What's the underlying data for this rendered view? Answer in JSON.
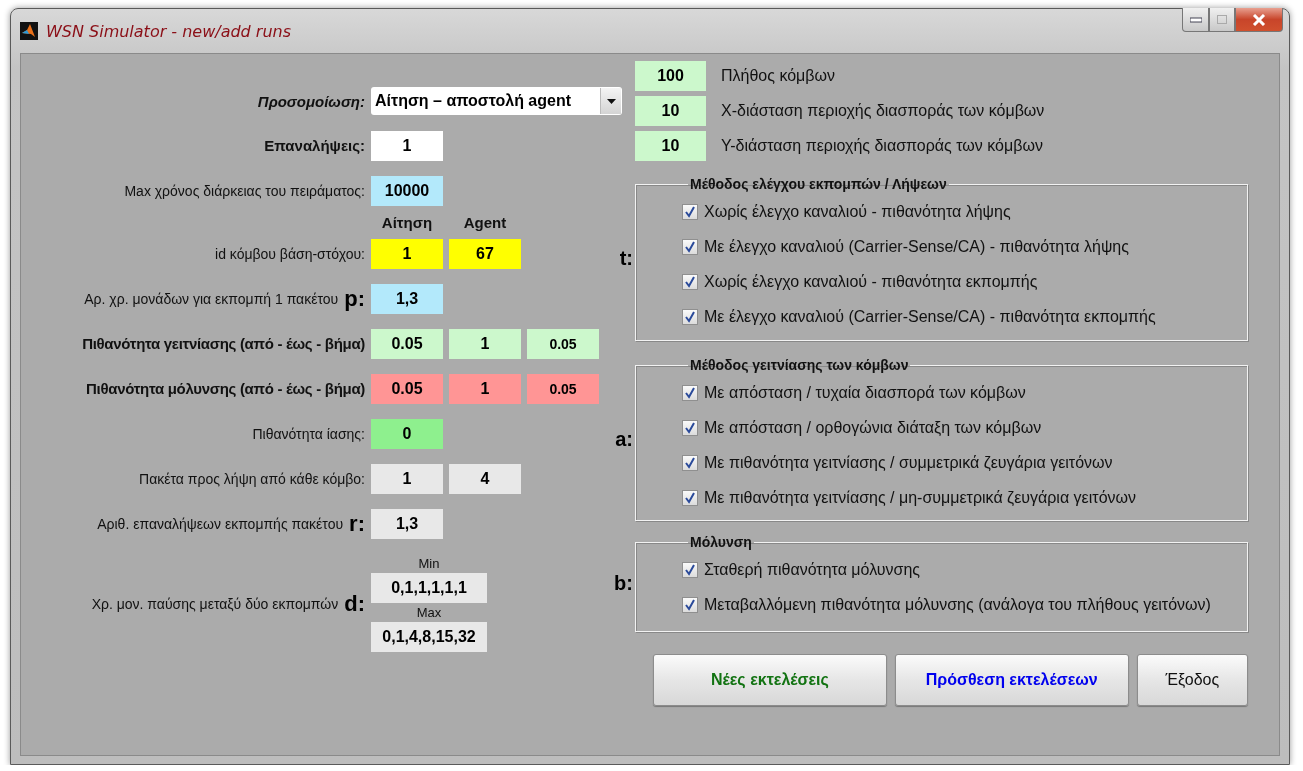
{
  "window": {
    "title": "WSN Simulator - new/add runs"
  },
  "simulation": {
    "label": "Προσομοίωση:",
    "value": "Αίτηση – αποστολή agent"
  },
  "left_rows": [
    {
      "kind": "field",
      "label": "Επαναλήψεις:",
      "fields": [
        {
          "value": "1",
          "color": "#ffffff"
        }
      ]
    },
    {
      "kind": "field",
      "label": "Max χρόνος διάρκειας του πειράματος:",
      "fields": [
        {
          "value": "10000",
          "color": "#b3e9fb"
        }
      ]
    },
    {
      "kind": "header",
      "headers": [
        "Αίτηση",
        "Agent"
      ]
    },
    {
      "kind": "field",
      "label": "id κόμβου βάση-στόχου:",
      "fields": [
        {
          "value": "1",
          "color": "#ffff00"
        },
        {
          "value": "67",
          "color": "#ffff00"
        }
      ]
    },
    {
      "kind": "field",
      "label": "Αρ. χρ. μονάδων για εκπομπή 1 πακέτου",
      "letter": "p:",
      "fields": [
        {
          "value": "1,3",
          "color": "#b3e9fb"
        }
      ]
    },
    {
      "kind": "field",
      "label": "Πιθανότητα γειτνίασης (από - έως - βήμα)",
      "fields": [
        {
          "value": "0.05",
          "color": "#ccf8cc"
        },
        {
          "value": "1",
          "color": "#ccf8cc"
        },
        {
          "value": "0.05",
          "color": "#ccf8cc"
        }
      ]
    },
    {
      "kind": "field",
      "label": "Πιθανότητα μόλυνσης (από - έως - βήμα)",
      "fields": [
        {
          "value": "0.05",
          "color": "#ff9595"
        },
        {
          "value": "1",
          "color": "#ff9595"
        },
        {
          "value": "0.05",
          "color": "#ff9595"
        }
      ]
    },
    {
      "kind": "field",
      "label": "Πιθανότητα ίασης:",
      "fields": [
        {
          "value": "0",
          "color": "#8ef08e"
        }
      ]
    },
    {
      "kind": "field",
      "label": "Πακέτα προς λήψη από κάθε κόμβο:",
      "fields": [
        {
          "value": "1",
          "color": "#e8e8e8"
        },
        {
          "value": "4",
          "color": "#e8e8e8"
        }
      ]
    },
    {
      "kind": "field",
      "label": "Αριθ. επαναλήψεων εκπομπής πακέτου",
      "letter": "r:",
      "fields": [
        {
          "value": "1,3",
          "color": "#e8e8e8"
        }
      ]
    },
    {
      "kind": "range",
      "label": "Χρ. μον. παύσης μεταξύ δύο εκπομπών",
      "letter": "d:",
      "min_label": "Min",
      "min": "0,1,1,1,1,1",
      "max_label": "Max",
      "max": "0,1,4,8,15,32",
      "color": "#e8e8e8"
    }
  ],
  "right_fields": [
    {
      "value": "100",
      "label": "Πλήθος κόμβων",
      "color": "#ccf8cc"
    },
    {
      "value": "10",
      "label": "Χ-διάσταση περιοχής διασποράς των κόμβων",
      "color": "#ccf8cc"
    },
    {
      "value": "10",
      "label": "Υ-διάσταση περιοχής διασποράς των κόμβων",
      "color": "#ccf8cc"
    }
  ],
  "groups": [
    {
      "letter": "t:",
      "title": "Μέθοδος ελέγχου εκπομπών / Λήψεων",
      "options": [
        {
          "label": "Χωρίς έλεγχο καναλιού - πιθανότητα λήψης",
          "checked": true
        },
        {
          "label": "Με έλεγχο καναλιού (Carrier-Sense/CA) - πιθανότητα λήψης",
          "checked": true
        },
        {
          "label": "Χωρίς έλεγχο καναλιού - πιθανότητα εκπομπής",
          "checked": true
        },
        {
          "label": "Με έλεγχο καναλιού (Carrier-Sense/CA) - πιθανότητα εκπομπής",
          "checked": true
        }
      ]
    },
    {
      "letter": "a:",
      "title": "Μέθοδος γειτνίασης των κόμβων",
      "options": [
        {
          "label": "Με απόσταση / τυχαία διασπορά των κόμβων",
          "checked": true
        },
        {
          "label": "Με απόσταση / ορθογώνια διάταξη των κόμβων",
          "checked": true
        },
        {
          "label": "Με πιθανότητα γειτνίασης / συμμετρικά ζευγάρια γειτόνων",
          "checked": true
        },
        {
          "label": "Με πιθανότητα γειτνίασης / μη-συμμετρικά ζευγάρια γειτόνων",
          "checked": true
        }
      ]
    },
    {
      "letter": "b:",
      "title": "Μόλυνση",
      "options": [
        {
          "label": "Σταθερή πιθανότητα μόλυνσης",
          "checked": true
        },
        {
          "label": "Μεταβαλλόμενη πιθανότητα μόλυνσης (ανάλογα του πλήθους γειτόνων)",
          "checked": true
        }
      ]
    }
  ],
  "buttons": [
    {
      "label": "Νέες εκτελέσεις",
      "color": "#127312"
    },
    {
      "label": "Πρόσθεση εκτελέσεων",
      "color": "#0000ee"
    },
    {
      "label": "Έξοδος",
      "color": "#111111"
    }
  ]
}
